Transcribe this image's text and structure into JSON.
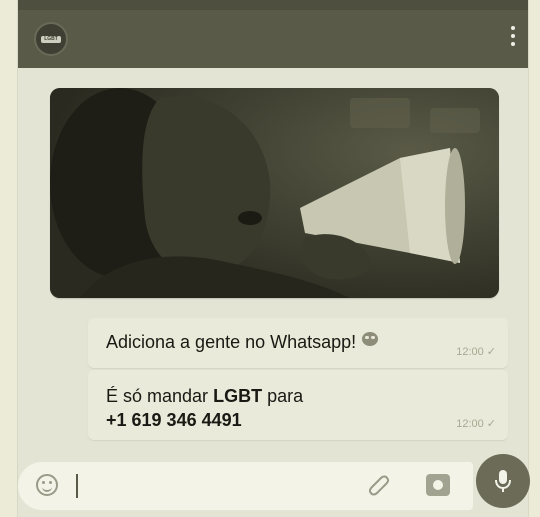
{
  "header": {
    "avatar_badge": "LGBT",
    "menu_icon": "more-vertical-icon"
  },
  "messages": [
    {
      "text": "Adiciona a gente no Whatsapp!",
      "emoji": "heart-eyes-emoji",
      "time": "12:00",
      "status": "✓"
    },
    {
      "line1_prefix": "É só mandar",
      "line1_bold": "LGBT",
      "line1_suffix": "para",
      "line2": "+1 619 346 4491",
      "time": "12:00",
      "status": "✓"
    }
  ],
  "composer": {
    "emoji_icon": "smiley-icon",
    "attach_icon": "paperclip-icon",
    "camera_icon": "camera-icon",
    "mic_icon": "microphone-icon"
  },
  "colors": {
    "header": "#5a5a49",
    "bubble": "#e9ead9",
    "background": "#e4e4d5",
    "mic_button": "#6b6b57"
  }
}
